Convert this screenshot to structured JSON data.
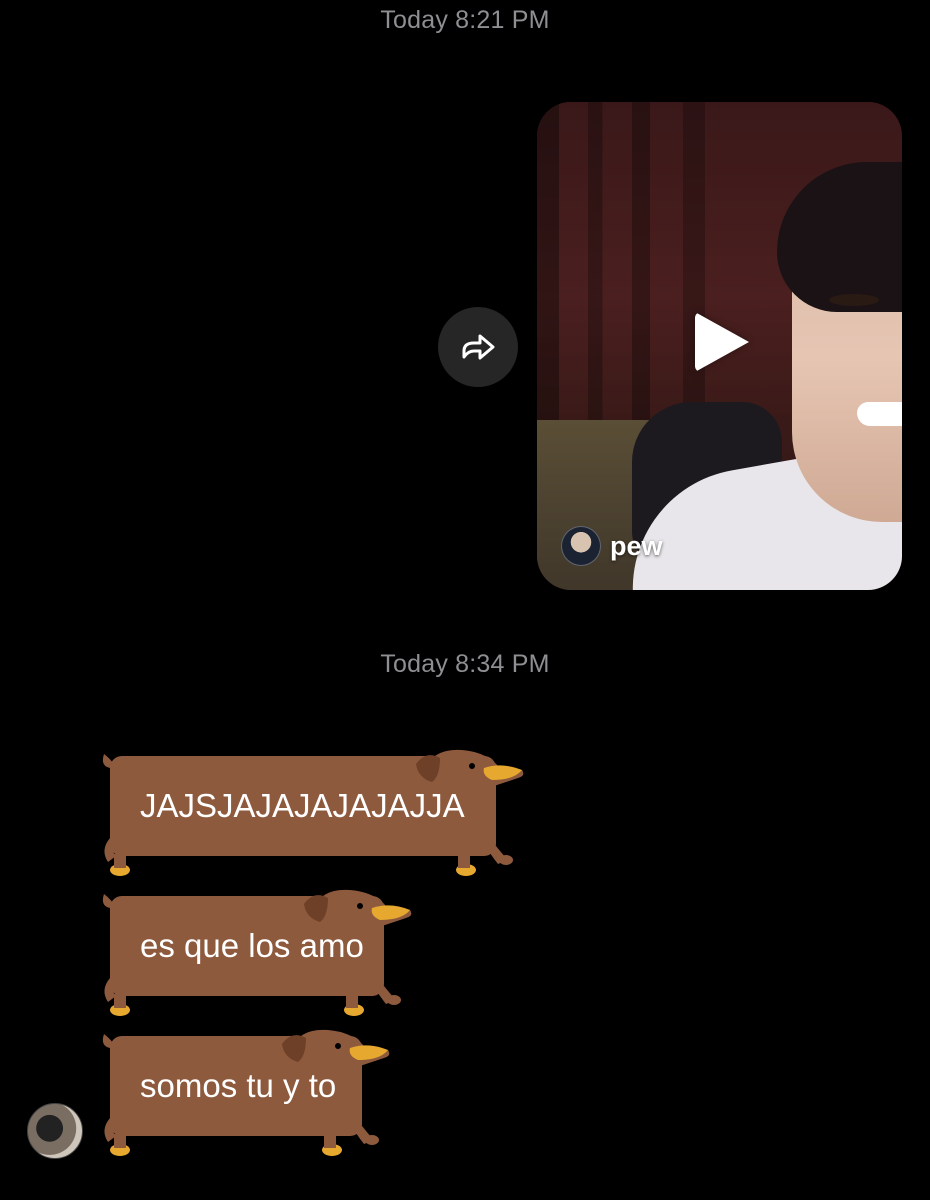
{
  "timestamps": [
    "Today 8:21 PM",
    "Today 8:34 PM"
  ],
  "shared_video": {
    "author": "pew",
    "author_avatar_icon": "profile-avatar",
    "play_icon": "play-icon",
    "share_icon": "share-arrow-icon"
  },
  "messages": [
    {
      "text": "JAJSJAJAJAJAJAJJA"
    },
    {
      "text": "es que los amo"
    },
    {
      "text": "somos tu y to"
    }
  ],
  "colors": {
    "background": "#000000",
    "bubble": "#8e5a3e",
    "timestamp": "#8e8e93",
    "share_button": "#262626"
  }
}
